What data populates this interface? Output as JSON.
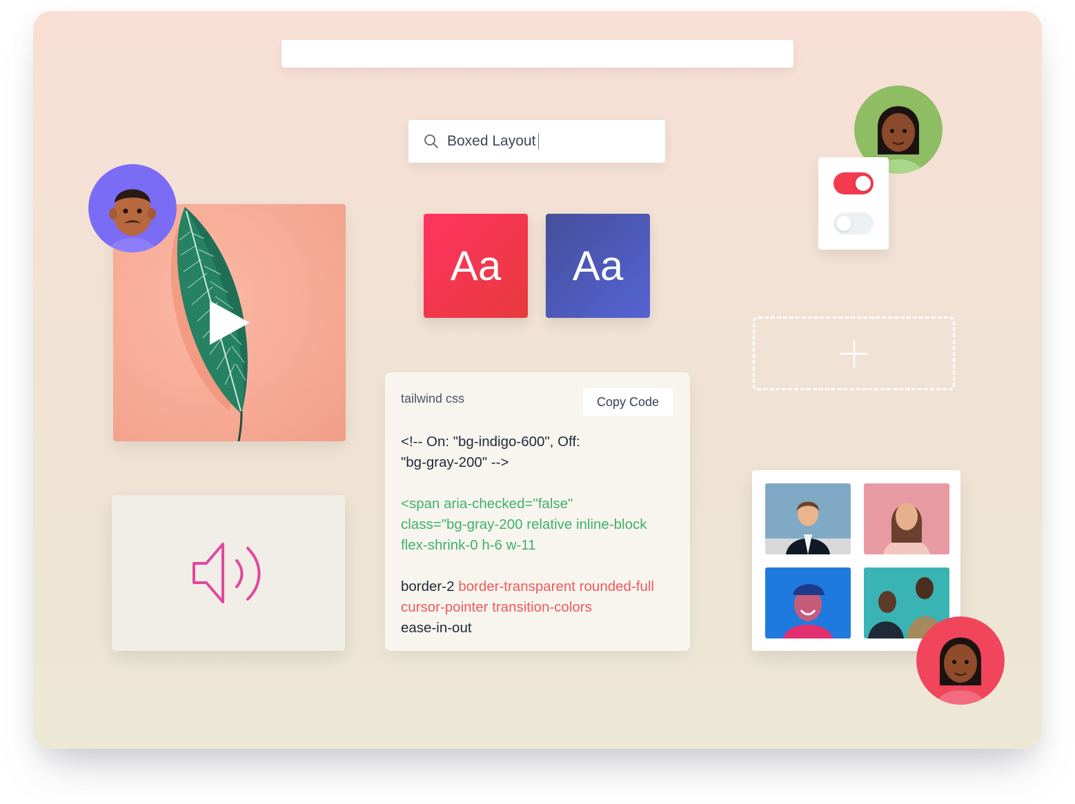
{
  "search": {
    "value": "Boxed Layout",
    "icon": "search-icon"
  },
  "tiles": [
    {
      "label": "Aa",
      "color": "#fe3461"
    },
    {
      "label": "Aa",
      "color": "#4b58b8"
    }
  ],
  "code_card": {
    "language": "tailwind css",
    "copy_label": "Copy Code",
    "comment_line_1": "<!-- On: \"bg-indigo-600\", Off:",
    "comment_line_2": "\"bg-gray-200\" -->",
    "green_line_1": "<span aria-checked=\"false\"",
    "green_line_2": "class=\"bg-gray-200 relative inline-block",
    "green_line_3": "flex-shrink-0 h-6 w-11",
    "plain_1": "border-2",
    "red_1": "border-transparent rounded-full",
    "red_2": "cursor-pointer transition-colors",
    "plain_2": "ease-in-out"
  },
  "toggles": [
    {
      "state": "on",
      "color": "#f33a4f"
    },
    {
      "state": "off",
      "color": "#eef1f4"
    }
  ],
  "media": {
    "video_icon": "play-icon",
    "audio_icon": "speaker-icon",
    "add_icon": "plus-icon"
  },
  "colors": {
    "accent_red": "#f33a4f",
    "accent_indigo": "#5563d4",
    "code_green": "#3fb06a",
    "code_red": "#f0595a"
  }
}
